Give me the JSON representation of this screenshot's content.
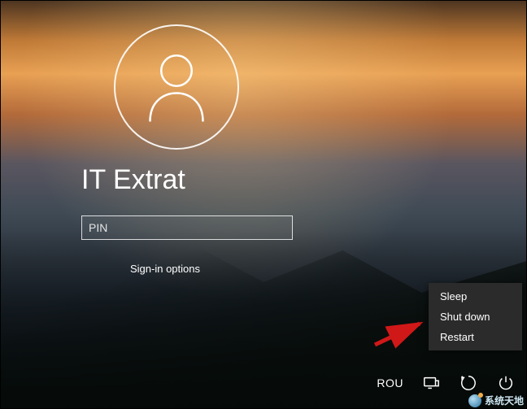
{
  "login": {
    "username": "IT Extrat",
    "pin_placeholder": "PIN",
    "signin_options_label": "Sign-in options"
  },
  "power_menu": {
    "items": [
      {
        "label": "Sleep"
      },
      {
        "label": "Shut down"
      },
      {
        "label": "Restart"
      }
    ]
  },
  "corner": {
    "language": "ROU"
  },
  "watermark": {
    "text": "系统天地"
  }
}
